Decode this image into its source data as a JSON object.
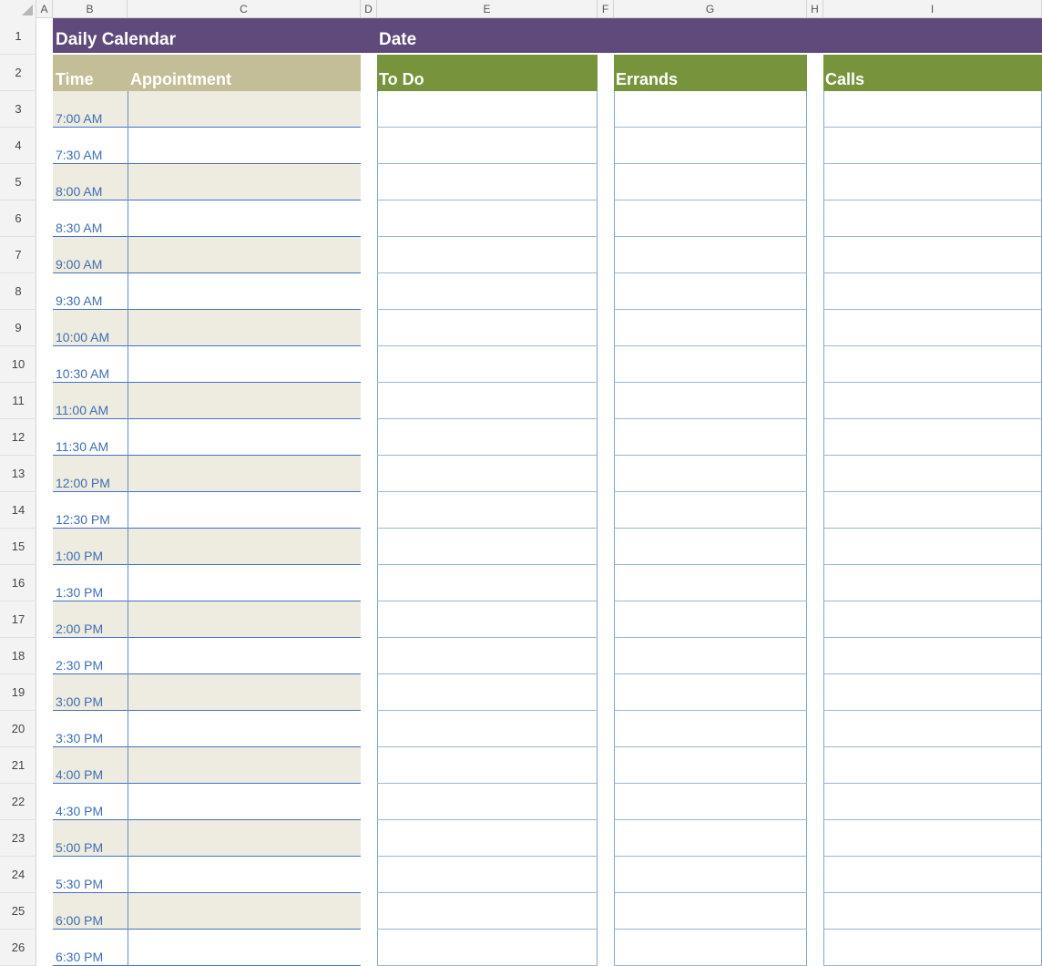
{
  "columns": [
    "A",
    "B",
    "C",
    "D",
    "E",
    "F",
    "G",
    "H",
    "I"
  ],
  "rows": [
    "1",
    "2",
    "3",
    "4",
    "5",
    "6",
    "7",
    "8",
    "9",
    "10",
    "11",
    "12",
    "13",
    "14",
    "15",
    "16",
    "17",
    "18",
    "19",
    "20",
    "21",
    "22",
    "23",
    "24",
    "25",
    "26"
  ],
  "title": "Daily Calendar",
  "date_label": "Date",
  "headers": {
    "time": "Time",
    "appointment": "Appointment",
    "todo": "To Do",
    "errands": "Errands",
    "calls": "Calls"
  },
  "times": [
    "7:00 AM",
    "7:30 AM",
    "8:00 AM",
    "8:30 AM",
    "9:00 AM",
    "9:30 AM",
    "10:00 AM",
    "10:30 AM",
    "11:00 AM",
    "11:30 AM",
    "12:00 PM",
    "12:30 PM",
    "1:00 PM",
    "1:30 PM",
    "2:00 PM",
    "2:30 PM",
    "3:00 PM",
    "3:30 PM",
    "4:00 PM",
    "4:30 PM",
    "5:00 PM",
    "5:30 PM",
    "6:00 PM",
    "6:30 PM"
  ],
  "colors": {
    "title_band": "#5f4a7b",
    "schedule_header": "#c4be98",
    "list_header": "#77933c",
    "shaded_row": "#eeebe0",
    "time_text": "#3f6fb0"
  }
}
